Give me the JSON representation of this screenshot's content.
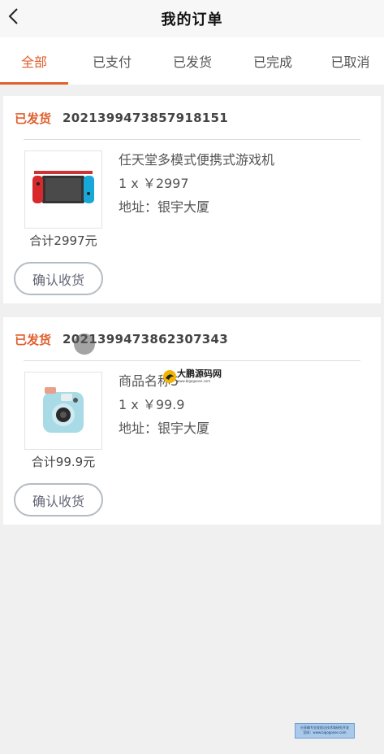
{
  "header": {
    "title": "我的订单"
  },
  "tabs": [
    {
      "label": "全部",
      "active": true
    },
    {
      "label": "已支付"
    },
    {
      "label": "已发货"
    },
    {
      "label": "已完成"
    },
    {
      "label": "已取消"
    }
  ],
  "orders": [
    {
      "status": "已发货",
      "order_no": "2021399473857918151",
      "product_name": "任天堂多模式便携式游戏机",
      "qty_price": "1 x ￥2997",
      "address": "地址：银宇大厦",
      "total": "合计2997元",
      "button": "确认收货",
      "image_icon": "game-console-icon"
    },
    {
      "status": "已发货",
      "order_no": "2021399473862307343",
      "product_name": "商品名称5",
      "qty_price": "1 x ￥99.9",
      "address": "地址：银宇大厦",
      "total": "合计99.9元",
      "button": "确认收货",
      "image_icon": "instant-camera-icon"
    }
  ],
  "watermark": {
    "logo_text": "大鹏源码网",
    "logo_sub": "www.bigogoose.com",
    "banner_line1": "分享精专业发前沿技术和研究开发",
    "banner_line2": "官网：www.bigogoose.com"
  },
  "colors": {
    "accent": "#e0602e",
    "background": "#f0f0f0"
  }
}
